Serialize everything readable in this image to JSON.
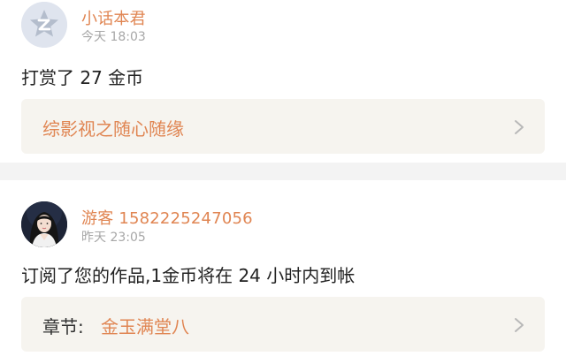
{
  "notifications": [
    {
      "user": "小话本君",
      "time": "今天 18:03",
      "message": "打赏了 27 金币",
      "link_title": "综影视之随心随缘"
    },
    {
      "user": "游客 1582225247056",
      "time": "昨天 23:05",
      "message": "订阅了您的作品,1金币将在 24 小时内到帐",
      "chapter_label": "章节:",
      "chapter_name": "金玉满堂八"
    }
  ],
  "colors": {
    "accent": "#e08552",
    "divider": "#f3f3f3",
    "link_bg": "#f6f4ef"
  },
  "icons": {
    "avatar1": "qq-default-avatar-icon",
    "chevron": "chevron-right-icon"
  }
}
